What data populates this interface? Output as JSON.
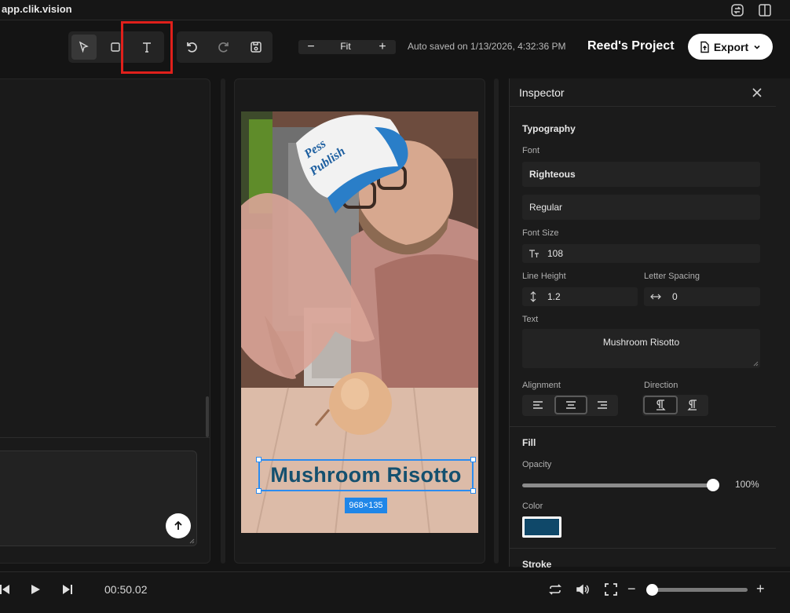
{
  "browser": {
    "site_url": "app.clik.vision"
  },
  "toolbar": {
    "tools": [
      "select-tool",
      "rectangle-tool",
      "text-tool"
    ],
    "active_tool": "select-tool",
    "history": [
      "undo",
      "redo",
      "save"
    ],
    "zoom": {
      "level": "Fit",
      "minus": "−",
      "plus": "+"
    },
    "autosave": "Auto saved on 1/13/2026, 4:32:36 PM",
    "project_name": "Reed's Project",
    "export_label": "Export"
  },
  "canvas": {
    "overlay_text": "Mushroom Risotto",
    "overlay_size": "968×135",
    "cap_text_top": "Pess",
    "cap_text_bottom": "Publish"
  },
  "inspector": {
    "title": "Inspector",
    "typography": {
      "section": "Typography",
      "font_label": "Font",
      "font_value": "Righteous",
      "weight_value": "Regular",
      "font_size_label": "Font Size",
      "font_size_value": "108",
      "line_height_label": "Line Height",
      "line_height_value": "1.2",
      "letter_spacing_label": "Letter Spacing",
      "letter_spacing_value": "0",
      "text_label": "Text",
      "text_value": "Mushroom Risotto",
      "alignment_label": "Alignment",
      "alignment_options": [
        "left",
        "center",
        "right"
      ],
      "alignment_selected": "center",
      "direction_label": "Direction",
      "direction_options": [
        "ltr",
        "rtl"
      ],
      "direction_selected": "ltr"
    },
    "fill": {
      "section": "Fill",
      "opacity_label": "Opacity",
      "opacity_value": "100%",
      "opacity_fraction": 1.0,
      "color_label": "Color",
      "color_hex": "#0f4869"
    },
    "stroke": {
      "section": "Stroke"
    }
  },
  "transport": {
    "timecode": "00:50.02",
    "volume_fraction": 0.0
  },
  "colors": {
    "accent_blue": "#2b8cf0",
    "highlight_red": "#e0201b",
    "text_overlay": "#14506f"
  }
}
